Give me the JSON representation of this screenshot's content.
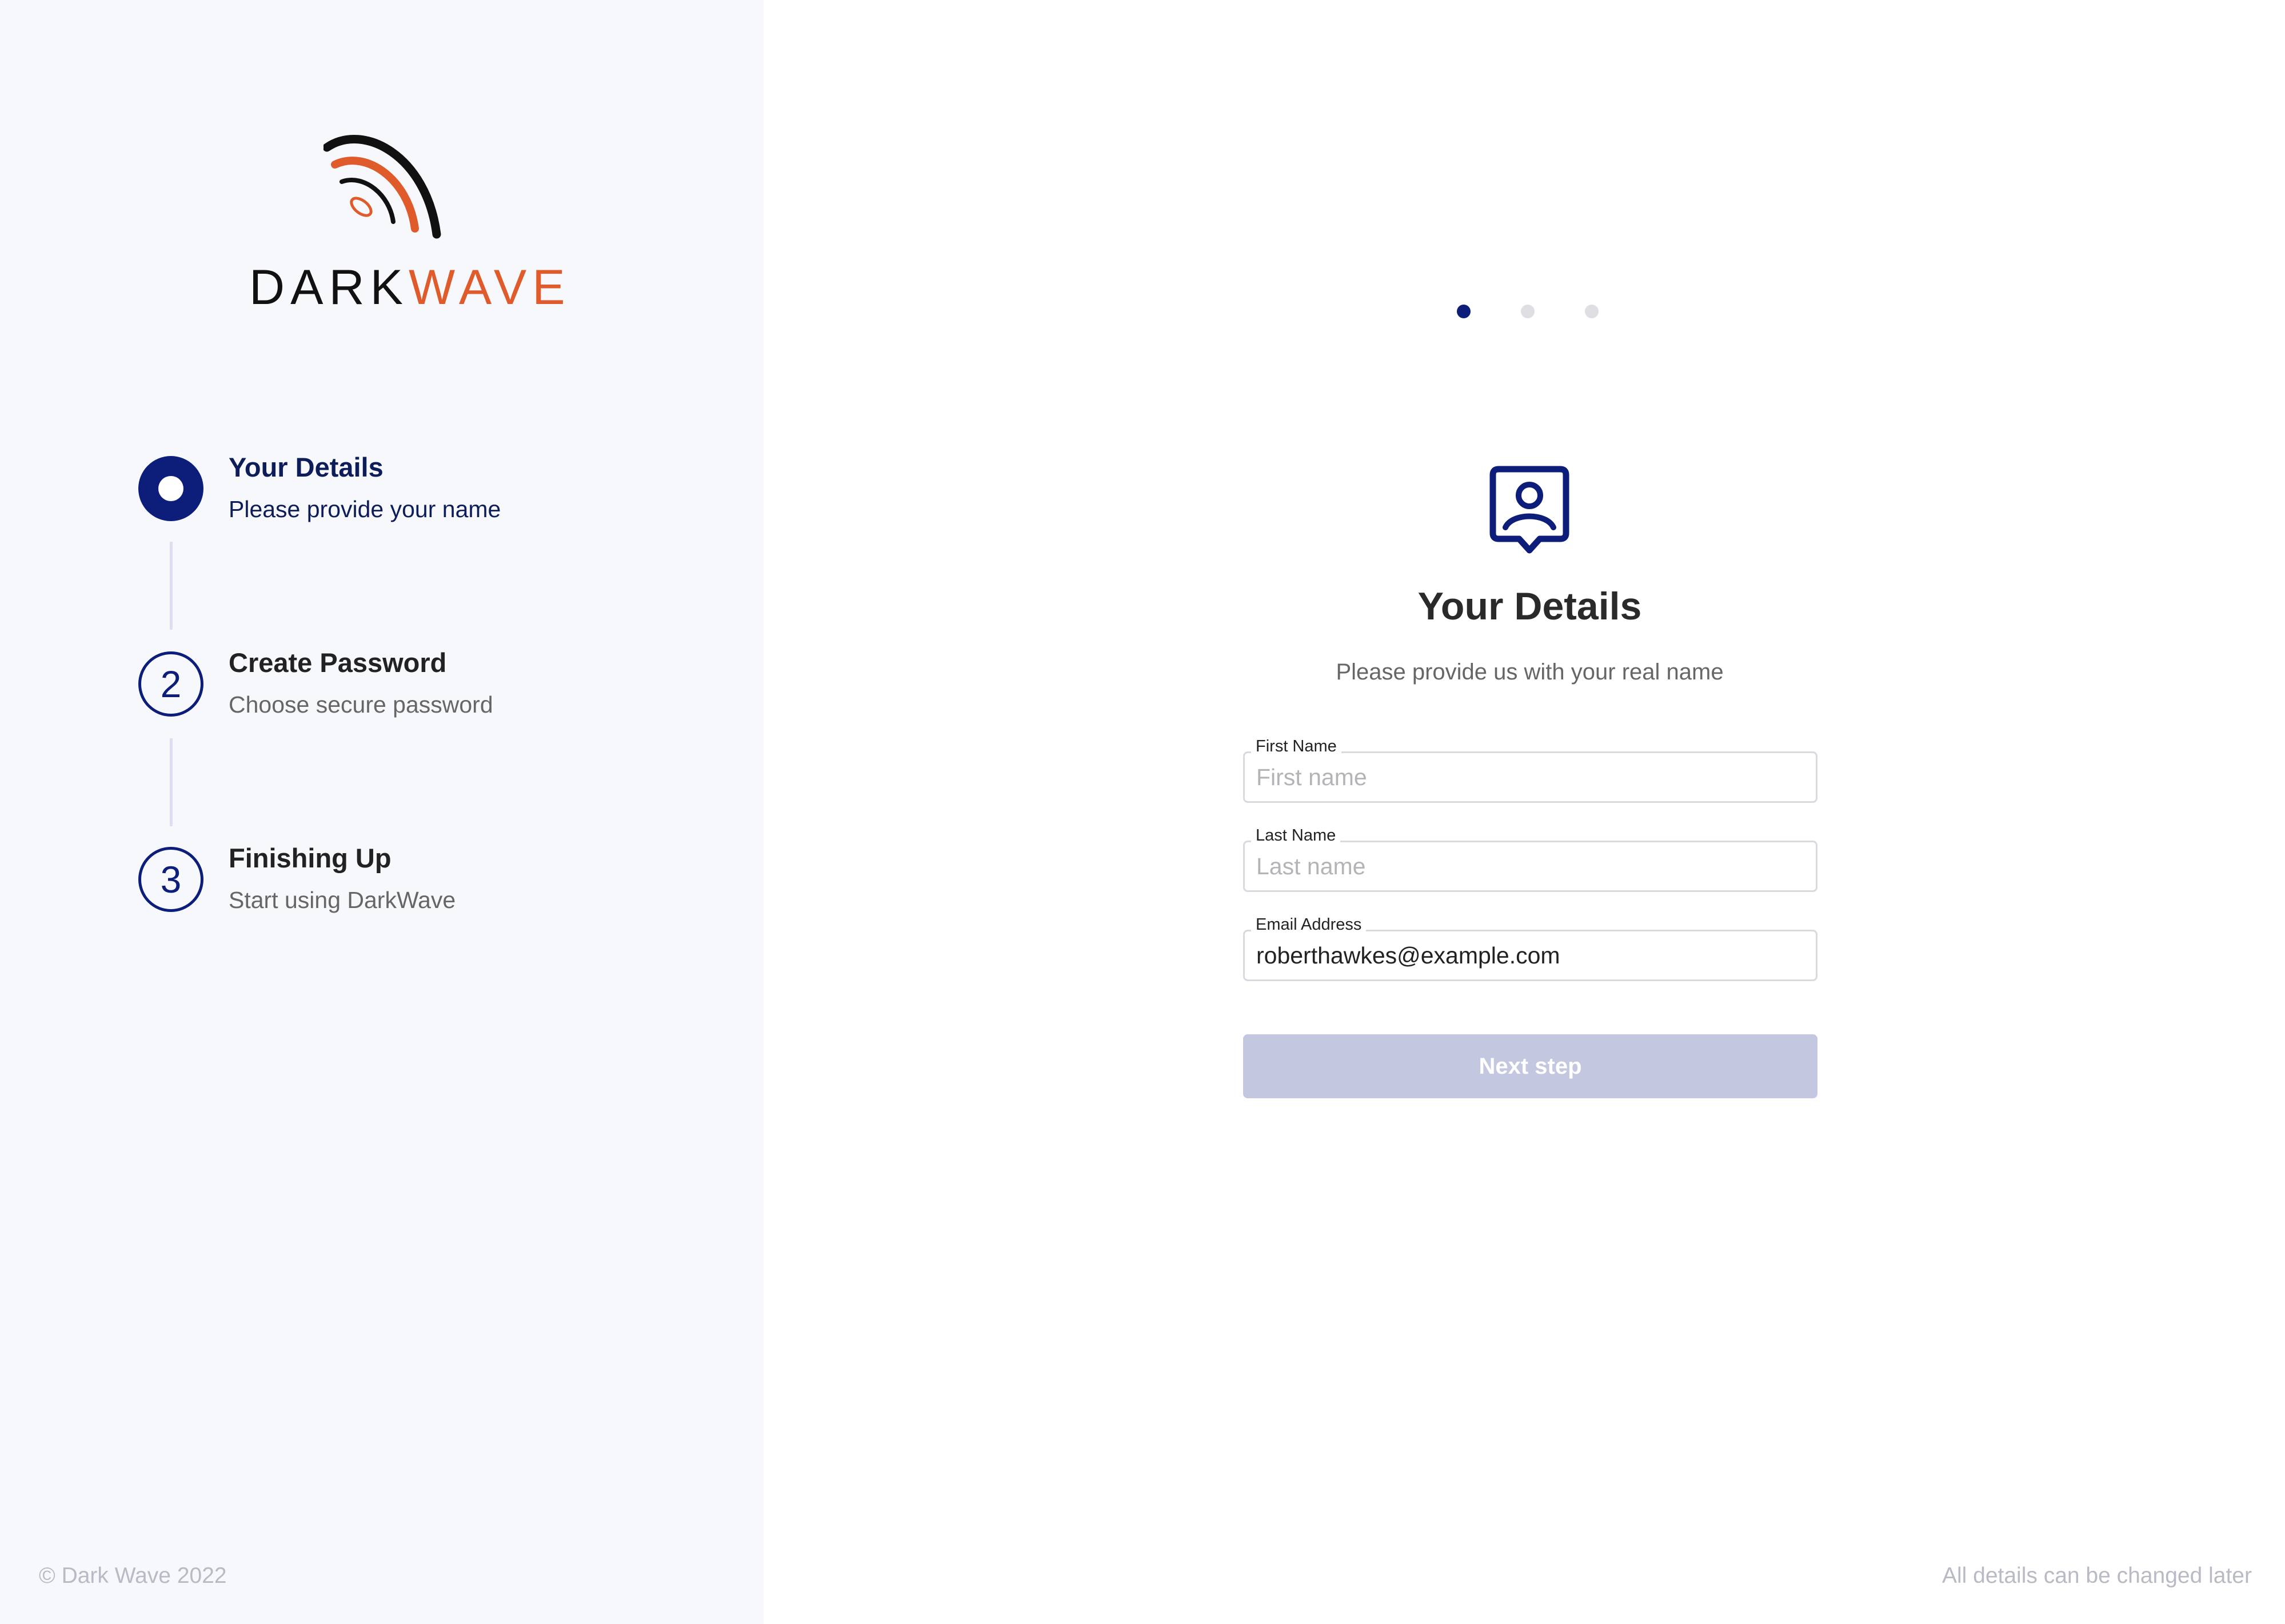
{
  "brand": {
    "dark": "DARK",
    "wave": "WAVE"
  },
  "steps": [
    {
      "number": "",
      "title": "Your Details",
      "description": "Please provide your name",
      "state": "active"
    },
    {
      "number": "2",
      "title": "Create Password",
      "description": "Choose secure password",
      "state": "pending"
    },
    {
      "number": "3",
      "title": "Finishing Up",
      "description": "Start using DarkWave",
      "state": "pending"
    }
  ],
  "pager": {
    "total": 3,
    "current": 1
  },
  "form": {
    "icon": "user-badge-icon",
    "title": "Your Details",
    "subtitle": "Please provide us with your real name",
    "fields": {
      "first_name": {
        "label": "First Name",
        "placeholder": "First name",
        "value": ""
      },
      "last_name": {
        "label": "Last Name",
        "placeholder": "Last name",
        "value": ""
      },
      "email": {
        "label": "Email Address",
        "placeholder": "",
        "value": "roberthawkes@example.com"
      }
    },
    "next_label": "Next step"
  },
  "footer": {
    "copyright": "© Dark Wave 2022",
    "note": "All details can be changed later"
  },
  "colors": {
    "primary": "#0d1d7a",
    "brand_orange": "#e05b2c",
    "sidebar_bg": "#f7f8fc",
    "button_disabled": "#c3c7df"
  }
}
